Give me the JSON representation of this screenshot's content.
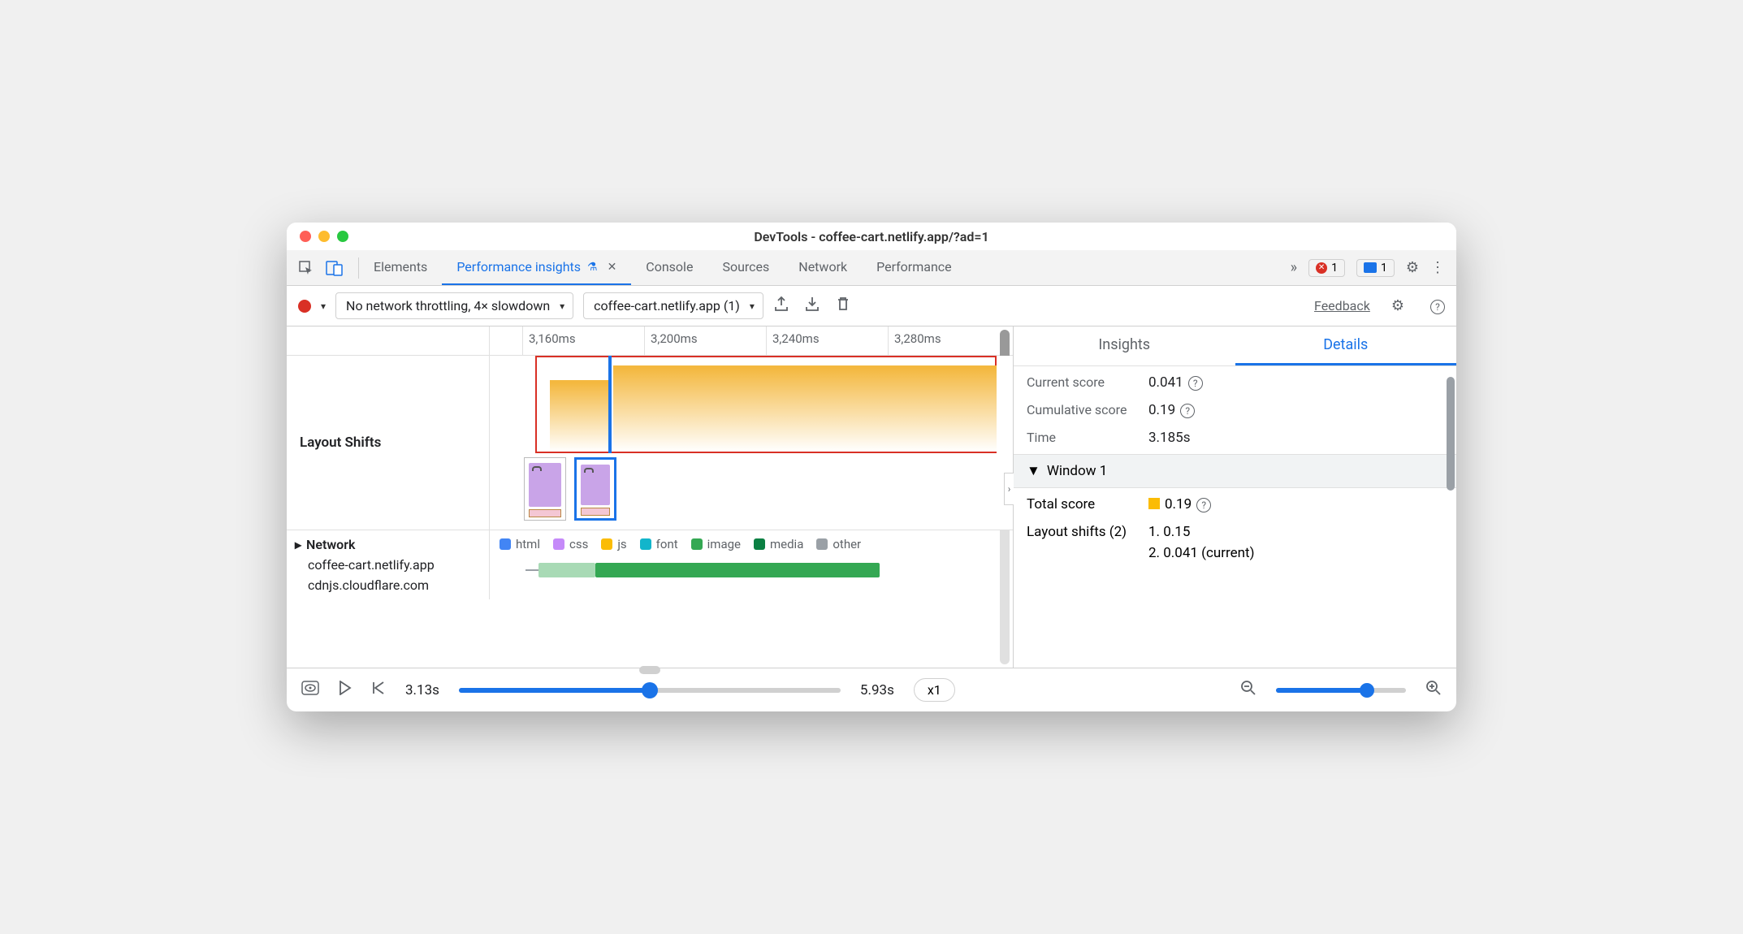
{
  "window": {
    "title": "DevTools - coffee-cart.netlify.app/?ad=1"
  },
  "tabbar": {
    "tabs": [
      "Elements",
      "Performance insights",
      "Console",
      "Sources",
      "Network",
      "Performance"
    ],
    "active_index": 1,
    "errors_count": "1",
    "messages_count": "1"
  },
  "toolbar": {
    "throttling": "No network throttling, 4× slowdown",
    "recording": "coffee-cart.netlify.app (1)",
    "feedback": "Feedback"
  },
  "timeline": {
    "ticks": [
      "3,160ms",
      "3,200ms",
      "3,240ms",
      "3,280ms"
    ],
    "layout_shifts_label": "Layout Shifts",
    "network_label": "Network",
    "hosts": [
      "coffee-cart.netlify.app",
      "cdnjs.cloudflare.com"
    ],
    "legend": [
      {
        "name": "html",
        "color": "#4285f4"
      },
      {
        "name": "css",
        "color": "#c58af9"
      },
      {
        "name": "js",
        "color": "#fbbc04"
      },
      {
        "name": "font",
        "color": "#12b5cb"
      },
      {
        "name": "image",
        "color": "#34a853"
      },
      {
        "name": "media",
        "color": "#0b8043"
      },
      {
        "name": "other",
        "color": "#9aa0a6"
      }
    ]
  },
  "details": {
    "tabs": [
      "Insights",
      "Details"
    ],
    "active_tab": 1,
    "current_score_label": "Current score",
    "current_score": "0.041",
    "cumulative_score_label": "Cumulative score",
    "cumulative_score": "0.19",
    "time_label": "Time",
    "time": "3.185s",
    "window_label": "Window 1",
    "total_score_label": "Total score",
    "total_score": "0.19",
    "layout_shifts_label": "Layout shifts (2)",
    "shifts": [
      "1. 0.15",
      "2. 0.041 (current)"
    ]
  },
  "footer": {
    "start_time": "3.13s",
    "end_time": "5.93s",
    "speed": "x1"
  }
}
